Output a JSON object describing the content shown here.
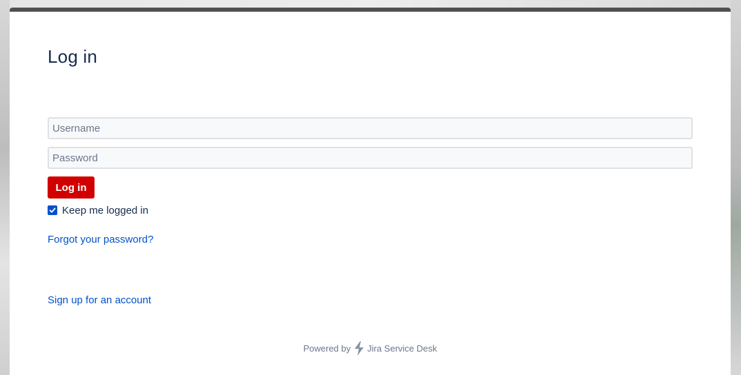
{
  "login": {
    "title": "Log in",
    "username": {
      "placeholder": "Username",
      "value": ""
    },
    "password": {
      "placeholder": "Password",
      "value": ""
    },
    "submit_label": "Log in",
    "remember": {
      "label": "Keep me logged in",
      "checked": true
    },
    "forgot_link": "Forgot your password?",
    "signup_link": "Sign up for an account"
  },
  "footer": {
    "powered_by": "Powered by",
    "product_name": "Jira Service Desk",
    "logo_icon": "jira-bolt-icon"
  },
  "colors": {
    "accent": "#d10000",
    "link": "#0052cc",
    "checkbox": "#0052cc",
    "title": "#172b4d",
    "top_bar": "#505050"
  }
}
